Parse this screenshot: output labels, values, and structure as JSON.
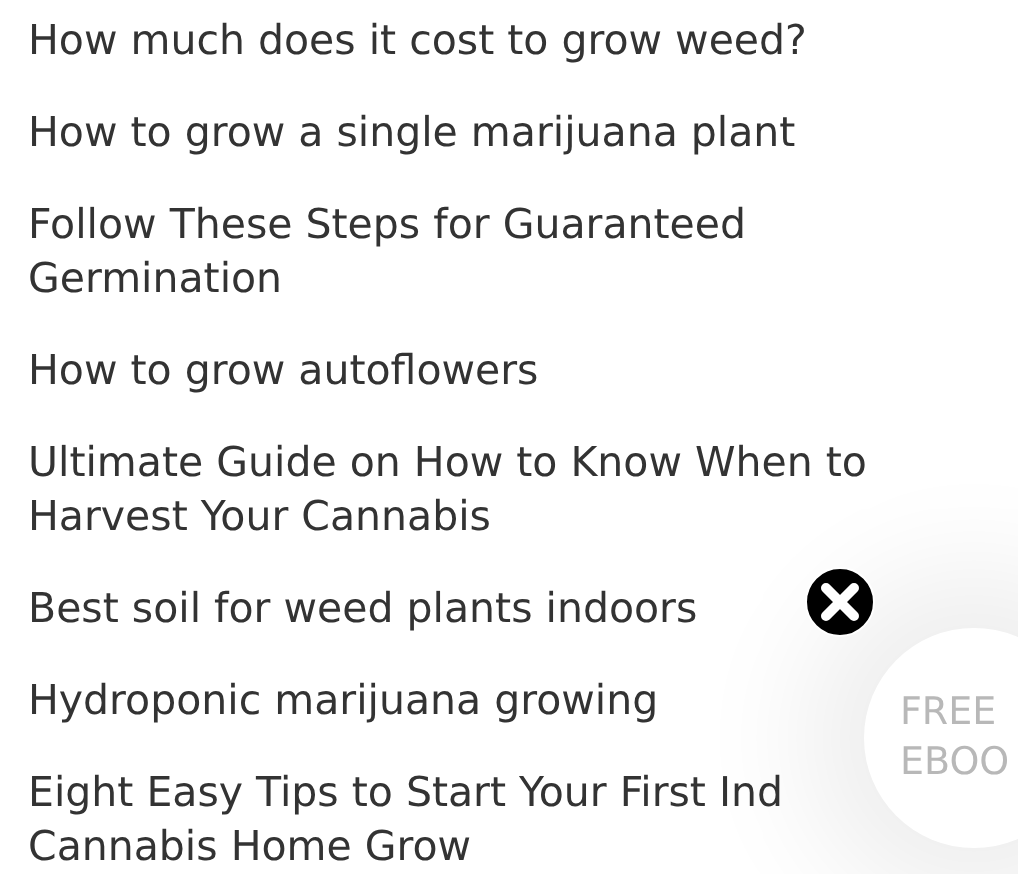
{
  "links": [
    {
      "lines": [
        "How much does it cost to grow weed?"
      ]
    },
    {
      "lines": [
        "How to grow a single marijuana plant"
      ]
    },
    {
      "lines": [
        "Follow These Steps for Guaranteed",
        "Germination"
      ]
    },
    {
      "lines": [
        "How to grow autoflowers"
      ]
    },
    {
      "lines": [
        "Ultimate Guide on How to Know When to",
        "Harvest Your Cannabis"
      ]
    },
    {
      "lines": [
        "Best soil for weed plants indoors"
      ]
    },
    {
      "lines": [
        "Hydroponic marijuana growing"
      ]
    },
    {
      "lines": [
        "Eight Easy Tips to Start Your First Ind",
        "Cannabis Home Grow"
      ]
    }
  ],
  "ebook_badge": {
    "lines": [
      "FREE",
      "EBOO"
    ]
  }
}
